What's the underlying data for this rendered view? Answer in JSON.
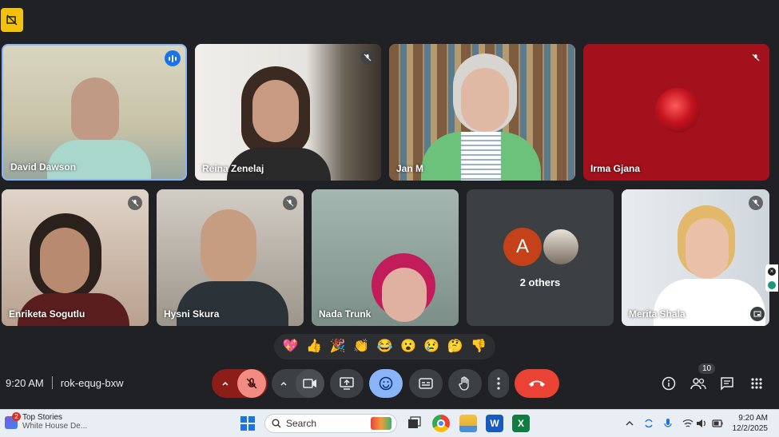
{
  "meeting": {
    "time": "9:20 AM",
    "code": "rok-equg-bxw",
    "participant_count": "10"
  },
  "participants": [
    {
      "name": "David Dawson",
      "speaking": true
    },
    {
      "name": "Reina Zenelaj",
      "muted": true
    },
    {
      "name": "Jan M"
    },
    {
      "name": "Irma Gjana",
      "muted": true
    },
    {
      "name": "Enriketa Sogutlu",
      "muted": true
    },
    {
      "name": "Hysni Skura",
      "muted": true
    },
    {
      "name": "Nada Trunk"
    },
    {
      "name": "Merita Shala",
      "muted": true
    }
  ],
  "others_tile": {
    "avatar_letter": "A",
    "label": "2 others"
  },
  "reactions": [
    "💖",
    "👍",
    "🎉",
    "👏",
    "😂",
    "😮",
    "😢",
    "🤔",
    "👎"
  ],
  "colors": {
    "end_call": "#ea4335",
    "mic_off": "#8c1d18",
    "emoji_active": "#8ab4f8",
    "speaking": "#1a73e8"
  },
  "taskbar": {
    "news_title": "Top Stories",
    "news_subtitle": "White House De...",
    "news_badge": "2",
    "search_placeholder": "Search",
    "clock_time": "9:20 AM",
    "clock_date": "12/2/2025"
  }
}
